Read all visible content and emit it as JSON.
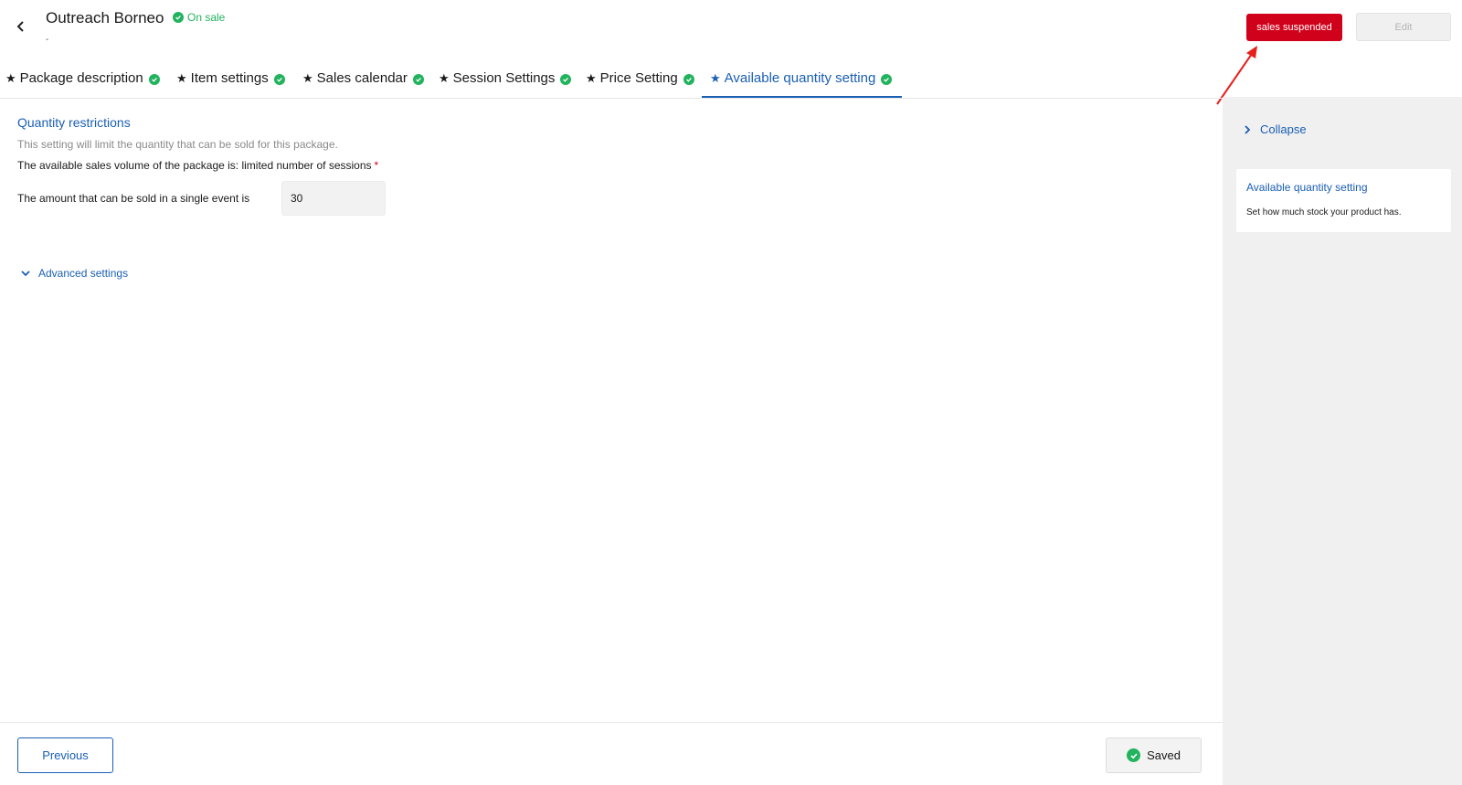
{
  "header": {
    "back_icon": "chevron-left-icon",
    "title": "Outreach Borneo",
    "status": "On sale",
    "status_color": "#22b35e",
    "sub_mark": "-",
    "suspend_label": "sales suspended",
    "suspend_color": "#d0021b",
    "edit_label": "Edit"
  },
  "tabs": [
    {
      "label": "Package description",
      "active": false
    },
    {
      "label": "Item settings",
      "active": false
    },
    {
      "label": "Sales calendar",
      "active": false
    },
    {
      "label": "Session Settings",
      "active": false
    },
    {
      "label": "Price Setting",
      "active": false
    },
    {
      "label": "Available quantity setting",
      "active": true
    }
  ],
  "main": {
    "section_title": "Quantity restrictions",
    "section_desc": "This setting will limit the quantity that can be sold for this package.",
    "volume_text": "The available sales volume of the package is: limited number of sessions",
    "required_mark": "*",
    "amount_label": "The amount that can be sold in a single event is",
    "amount_value": "30",
    "advanced_label": "Advanced settings"
  },
  "side_panel": {
    "collapse_label": "Collapse",
    "help_title": "Available quantity setting",
    "help_text": "Set how much stock your product has."
  },
  "footer": {
    "previous_label": "Previous",
    "saved_label": "Saved"
  },
  "colors": {
    "accent": "#1a5fb4",
    "success": "#22b35e",
    "danger": "#d0021b"
  }
}
